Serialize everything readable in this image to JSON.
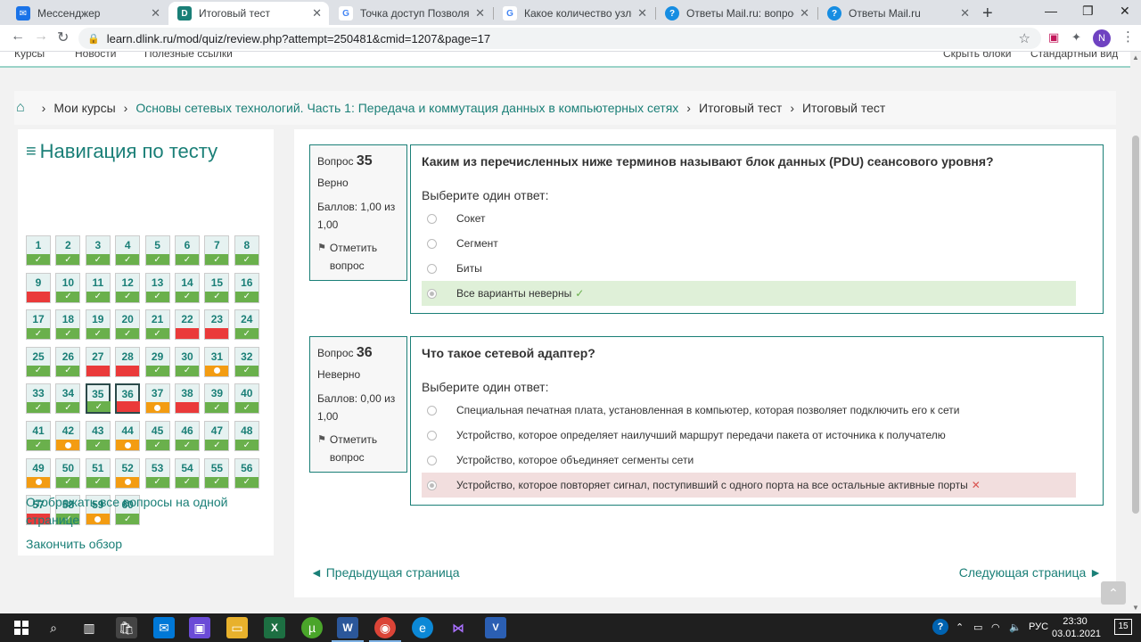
{
  "browser": {
    "tabs": [
      {
        "title": "Мессенджер",
        "icon": "messenger-icon",
        "color": "#1a73e8",
        "active": false
      },
      {
        "title": "Итоговый тест",
        "icon": "dlink-icon",
        "color": "#1a7f77",
        "active": true
      },
      {
        "title": "Точка доступ Позволяет об",
        "icon": "google-icon",
        "color": "#4285f4",
        "active": false
      },
      {
        "title": "Какое количество узлов до",
        "icon": "google-icon",
        "color": "#4285f4",
        "active": false
      },
      {
        "title": "Ответы Mail.ru: вопрос",
        "icon": "mailru-answers-icon",
        "color": "#168de2",
        "active": false
      },
      {
        "title": "Ответы Mail.ru",
        "icon": "mailru-answers-icon",
        "color": "#168de2",
        "active": false
      }
    ],
    "url": "learn.dlink.ru/mod/quiz/review.php?attempt=250481&cmid=1207&page=17",
    "profile_initial": "N"
  },
  "topnav": {
    "items": [
      "Курсы",
      "Новости",
      "Полезные ссылки"
    ],
    "right_items": [
      "Скрыть блоки",
      "Стандартный вид"
    ]
  },
  "breadcrumb": {
    "items": [
      {
        "label": "Мои курсы",
        "link": false
      },
      {
        "label": "Основы сетевых технологий. Часть 1: Передача и коммутация данных в компьютерных сетях",
        "link": true
      },
      {
        "label": "Итоговый тест",
        "link": false
      },
      {
        "label": "Итоговый тест",
        "link": false
      }
    ]
  },
  "quiz_nav": {
    "title": "Навигация по тесту",
    "questions": [
      {
        "n": "1",
        "state": "correct"
      },
      {
        "n": "2",
        "state": "correct"
      },
      {
        "n": "3",
        "state": "correct"
      },
      {
        "n": "4",
        "state": "correct"
      },
      {
        "n": "5",
        "state": "correct"
      },
      {
        "n": "6",
        "state": "correct"
      },
      {
        "n": "7",
        "state": "correct"
      },
      {
        "n": "8",
        "state": "correct"
      },
      {
        "n": "9",
        "state": "wrong"
      },
      {
        "n": "10",
        "state": "correct"
      },
      {
        "n": "11",
        "state": "correct"
      },
      {
        "n": "12",
        "state": "correct"
      },
      {
        "n": "13",
        "state": "correct"
      },
      {
        "n": "14",
        "state": "correct"
      },
      {
        "n": "15",
        "state": "correct"
      },
      {
        "n": "16",
        "state": "correct"
      },
      {
        "n": "17",
        "state": "correct"
      },
      {
        "n": "18",
        "state": "correct"
      },
      {
        "n": "19",
        "state": "correct"
      },
      {
        "n": "20",
        "state": "correct"
      },
      {
        "n": "21",
        "state": "correct"
      },
      {
        "n": "22",
        "state": "wrong"
      },
      {
        "n": "23",
        "state": "wrong"
      },
      {
        "n": "24",
        "state": "correct"
      },
      {
        "n": "25",
        "state": "correct"
      },
      {
        "n": "26",
        "state": "correct"
      },
      {
        "n": "27",
        "state": "wrong"
      },
      {
        "n": "28",
        "state": "wrong"
      },
      {
        "n": "29",
        "state": "correct"
      },
      {
        "n": "30",
        "state": "correct"
      },
      {
        "n": "31",
        "state": "partial"
      },
      {
        "n": "32",
        "state": "correct"
      },
      {
        "n": "33",
        "state": "correct"
      },
      {
        "n": "34",
        "state": "correct"
      },
      {
        "n": "35",
        "state": "correct"
      },
      {
        "n": "36",
        "state": "wrong"
      },
      {
        "n": "37",
        "state": "partial"
      },
      {
        "n": "38",
        "state": "wrong"
      },
      {
        "n": "39",
        "state": "correct"
      },
      {
        "n": "40",
        "state": "correct"
      },
      {
        "n": "41",
        "state": "correct"
      },
      {
        "n": "42",
        "state": "partial"
      },
      {
        "n": "43",
        "state": "correct"
      },
      {
        "n": "44",
        "state": "partial"
      },
      {
        "n": "45",
        "state": "correct"
      },
      {
        "n": "46",
        "state": "correct"
      },
      {
        "n": "47",
        "state": "correct"
      },
      {
        "n": "48",
        "state": "correct"
      },
      {
        "n": "49",
        "state": "partial"
      },
      {
        "n": "50",
        "state": "correct"
      },
      {
        "n": "51",
        "state": "correct"
      },
      {
        "n": "52",
        "state": "partial"
      },
      {
        "n": "53",
        "state": "correct"
      },
      {
        "n": "54",
        "state": "correct"
      },
      {
        "n": "55",
        "state": "correct"
      },
      {
        "n": "56",
        "state": "correct"
      },
      {
        "n": "57",
        "state": "wrong"
      },
      {
        "n": "58",
        "state": "correct"
      },
      {
        "n": "59",
        "state": "partial"
      },
      {
        "n": "60",
        "state": "correct"
      }
    ],
    "current": [
      "35",
      "36"
    ],
    "show_all_link": "Отображать все вопросы на одной странице",
    "finish_link": "Закончить обзор"
  },
  "questions": [
    {
      "label": "Вопрос",
      "number": "35",
      "status": "Верно",
      "score": "Баллов: 1,00 из 1,00",
      "flag_label": "Отметить вопрос",
      "text": "Каким из перечисленных ниже терминов называют блок данных (PDU) сеансового уровня?",
      "prompt": "Выберите один ответ:",
      "answers": [
        {
          "text": "Сокет",
          "selected": false,
          "mark": ""
        },
        {
          "text": "Сегмент",
          "selected": false,
          "mark": ""
        },
        {
          "text": "Биты",
          "selected": false,
          "mark": ""
        },
        {
          "text": "Все варианты неверны",
          "selected": true,
          "mark": "correct"
        }
      ]
    },
    {
      "label": "Вопрос",
      "number": "36",
      "status": "Неверно",
      "score": "Баллов: 0,00 из 1,00",
      "flag_label": "Отметить вопрос",
      "text": "Что такое сетевой адаптер?",
      "prompt": "Выберите один ответ:",
      "answers": [
        {
          "text": "Специальная печатная плата, установленная в компьютер, которая позволяет подключить его к сети",
          "selected": false,
          "mark": ""
        },
        {
          "text": "Устройство, которое определяет наилучший маршрут передачи пакета от источника к получателю",
          "selected": false,
          "mark": ""
        },
        {
          "text": "Устройство, которое объединяет сегменты сети",
          "selected": false,
          "mark": ""
        },
        {
          "text": "Устройство, которое повторяет сигнал, поступивший с одного порта на все остальные активные порты",
          "selected": true,
          "mark": "wrong"
        }
      ]
    }
  ],
  "pager": {
    "prev": "◄ Предыдущая страница",
    "next": "Следующая страница ►"
  },
  "taskbar": {
    "apps": [
      "search-icon",
      "task-view-icon",
      "store-icon",
      "mail-icon",
      "save-icon",
      "explorer-icon",
      "excel-icon",
      "torrent-icon",
      "word-icon",
      "chrome-icon",
      "edge-icon",
      "visual-studio-icon",
      "vs-code-icon"
    ],
    "lang": "РУС",
    "time": "23:30",
    "date": "03.01.2021",
    "notifications": "15"
  },
  "colors": {
    "accent": "#1a7f77",
    "correct": "#6ab04c",
    "wrong": "#ea3a3a",
    "partial": "#f39c12"
  }
}
